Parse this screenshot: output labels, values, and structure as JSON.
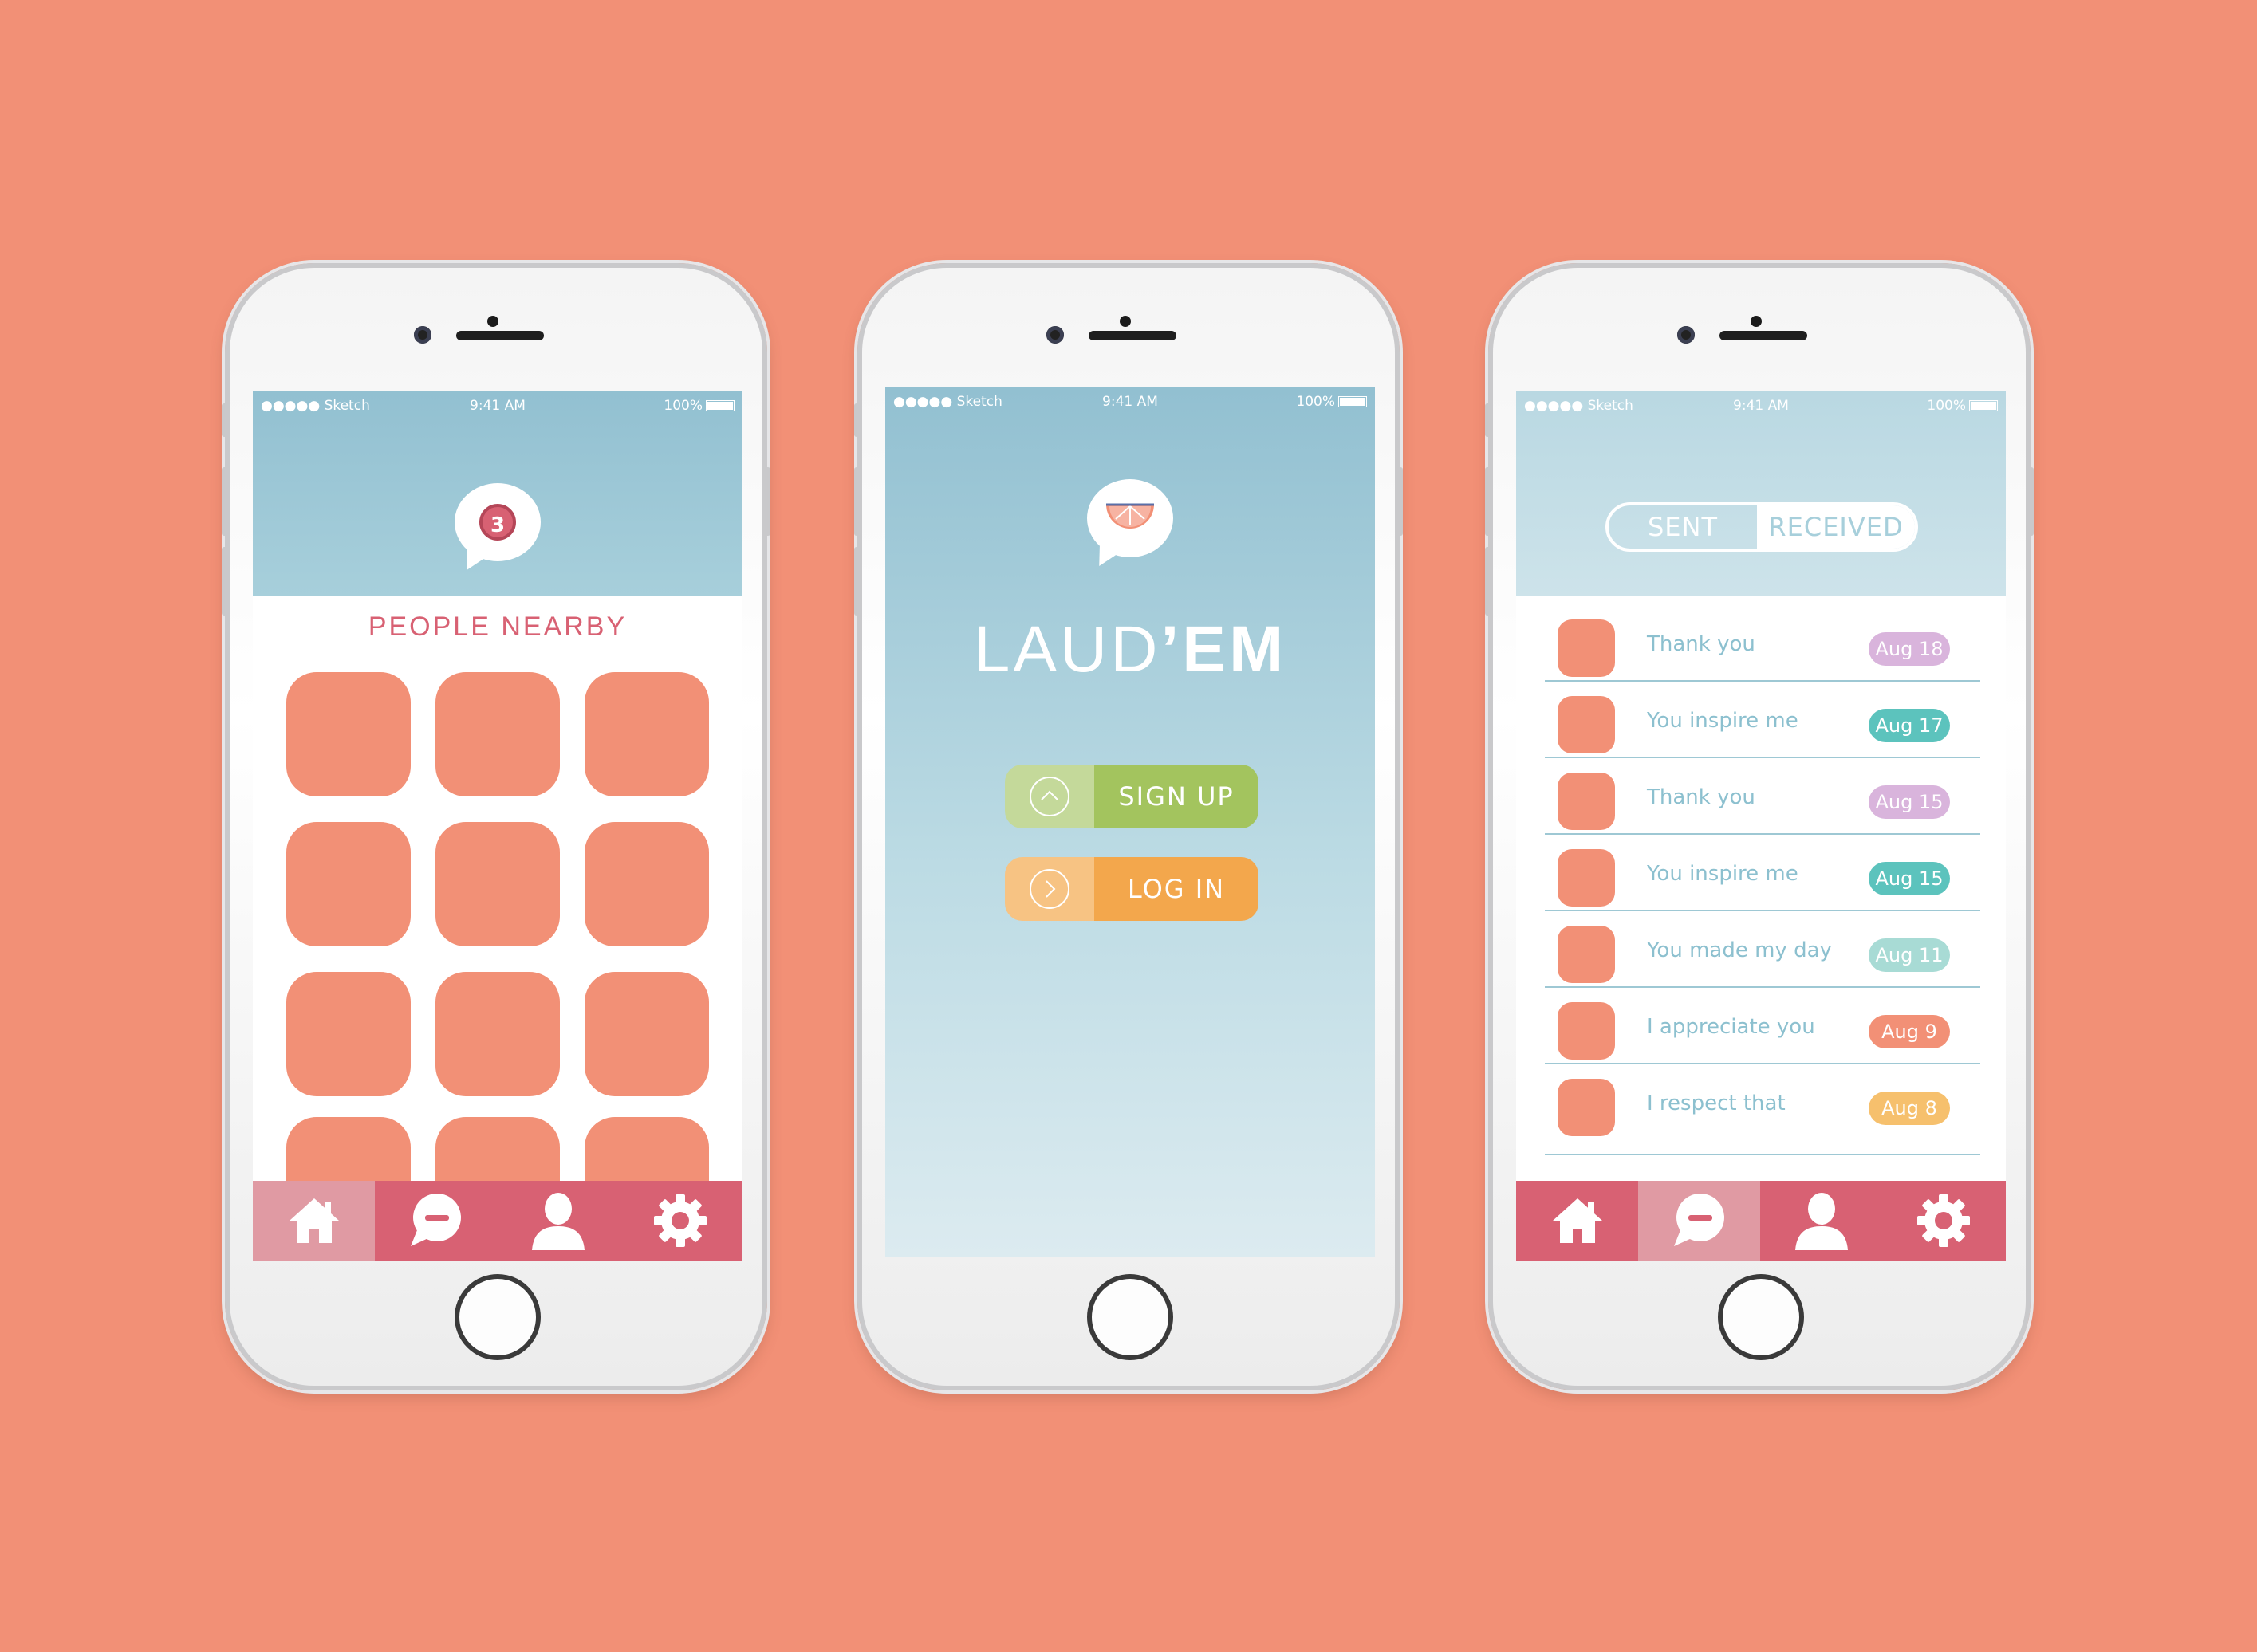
{
  "colors": {
    "background": "#f29076",
    "accent_pink": "#d86173",
    "accent_blue": "#92c0d1",
    "tile": "#f29076",
    "signup_green": "#a3c45e",
    "login_orange": "#f3a74c"
  },
  "status_bar": {
    "carrier": "●●●●● Sketch",
    "time": "9:41 AM",
    "battery": "100%"
  },
  "phone1": {
    "notification_count": "3",
    "title": "PEOPLE NEARBY",
    "tiles_count": 12,
    "tabs": [
      {
        "icon": "home-icon",
        "active": true
      },
      {
        "icon": "chat-icon",
        "active": false
      },
      {
        "icon": "user-icon",
        "active": false
      },
      {
        "icon": "gear-icon",
        "active": false
      }
    ]
  },
  "phone2": {
    "logo_light": "LAUD",
    "logo_bold": "’EM",
    "signup_label": "SIGN UP",
    "login_label": "LOG IN"
  },
  "phone3": {
    "segment": {
      "sent": "SENT",
      "received": "RECEIVED",
      "active": "received"
    },
    "messages": [
      {
        "text": "Thank you",
        "date": "Aug 18",
        "color": "#d9b4dc"
      },
      {
        "text": "You inspire me",
        "date": "Aug 17",
        "color": "#5cc3bd"
      },
      {
        "text": "Thank you",
        "date": "Aug 15",
        "color": "#d9b4dc"
      },
      {
        "text": "You inspire me",
        "date": "Aug 15",
        "color": "#5cc3bd"
      },
      {
        "text": "You made my day",
        "date": "Aug 11",
        "color": "#a8dbd5"
      },
      {
        "text": "I appreciate you",
        "date": "Aug 9",
        "color": "#f29076"
      },
      {
        "text": "I respect that",
        "date": "Aug 8",
        "color": "#f6c06d"
      }
    ]
  }
}
